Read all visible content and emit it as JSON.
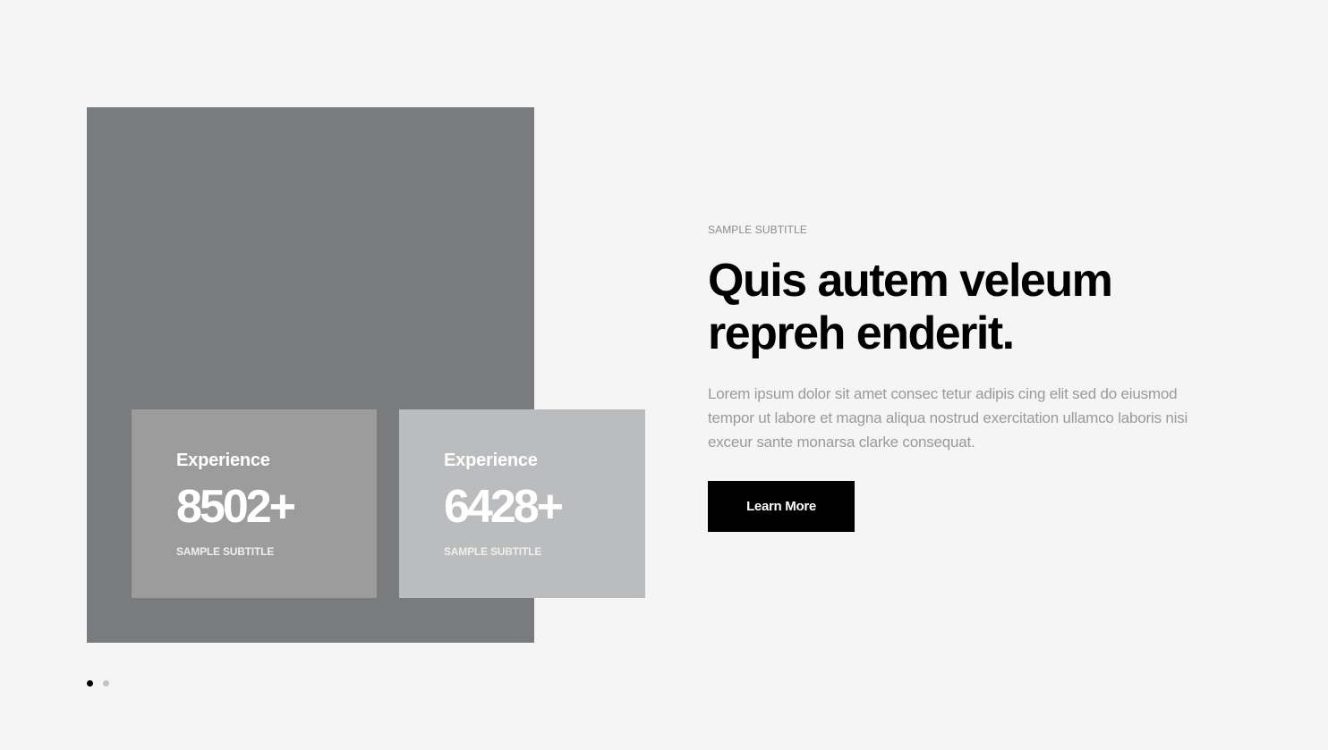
{
  "stats": [
    {
      "label": "Experience",
      "value": "8502+",
      "subtitle": "SAMPLE SUBTITLE"
    },
    {
      "label": "Experience",
      "value": "6428+",
      "subtitle": "SAMPLE SUBTITLE"
    }
  ],
  "content": {
    "subtitle": "SAMPLE SUBTITLE",
    "heading_line1": "Quis autem veleum",
    "heading_line2": "repreh enderit.",
    "body": "Lorem ipsum dolor sit amet consec tetur adipis cing elit sed do eiusmod tempor ut labore et magna aliqua nostrud exercitation ullamco laboris nisi exceur sante monarsa clarke consequat.",
    "button_label": "Learn More"
  },
  "carousel": {
    "slide_count": 2,
    "active_index": 0
  },
  "colors": {
    "background": "#f5f5f5",
    "image_placeholder": "#7a7b7c",
    "card_one": "#9c9c9d",
    "card_two": "#bbbcbd",
    "button": "#000000",
    "heading": "#000000"
  }
}
